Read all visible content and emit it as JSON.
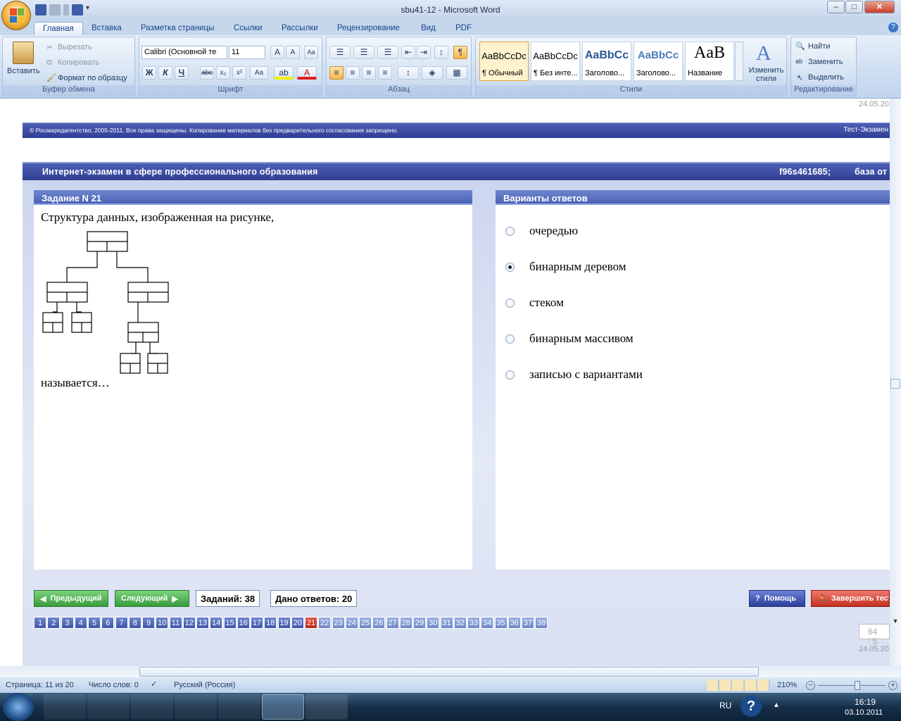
{
  "window": {
    "title": "sbu41-12 - Microsoft Word"
  },
  "tabs": [
    "Главная",
    "Вставка",
    "Разметка страницы",
    "Ссылки",
    "Рассылки",
    "Рецензирование",
    "Вид",
    "PDF"
  ],
  "ribbon": {
    "clipboard": {
      "paste": "Вставить",
      "cut": "Вырезать",
      "copy": "Копировать",
      "format_painter": "Формат по образцу",
      "label": "Буфер обмена"
    },
    "font": {
      "name": "Calibri (Основной те",
      "size": "11",
      "label": "Шрифт"
    },
    "paragraph": {
      "label": "Абзац"
    },
    "styles": {
      "items": [
        {
          "sample": "AaBbCcDc",
          "name": "¶ Обычный"
        },
        {
          "sample": "AaBbCcDc",
          "name": "¶ Без инте..."
        },
        {
          "sample": "AaBbCc",
          "name": "Заголово..."
        },
        {
          "sample": "AaBbCc",
          "name": "Заголово..."
        },
        {
          "sample": "AaB",
          "name": "Название"
        }
      ],
      "change": "Изменить стили",
      "label": "Стили"
    },
    "editing": {
      "find": "Найти",
      "replace": "Заменить",
      "select": "Выделить",
      "label": "Редактирование"
    }
  },
  "doc": {
    "date_top": "24.05.20",
    "copyright": "© Росаккредагентство, 2005-2011. Все права защищены. Копирование материалов без предварительного согласования запрещено.",
    "brand": "Тест-Экзамен",
    "exam_title": "Интернет-экзамен в сфере профессионального образования",
    "session": "f96s461685;",
    "base": "база от",
    "task_header": "Задание N 21",
    "question_start": "Структура данных, изображенная на рисунке,",
    "question_end": "называется…",
    "answers_header": "Варианты ответов",
    "answers": [
      {
        "text": "очередью",
        "selected": false
      },
      {
        "text": "бинарным деревом",
        "selected": true
      },
      {
        "text": "стеком",
        "selected": false
      },
      {
        "text": "бинарным массивом",
        "selected": false
      },
      {
        "text": "записью с вариантами",
        "selected": false
      }
    ],
    "prev": "Предыдущий",
    "next": "Следующий",
    "tasks_count": "Заданий: 38",
    "answered_count": "Дано ответов: 20",
    "help": "Помощь",
    "finish": "Завершить тест",
    "questions": [
      "1",
      "2",
      "3",
      "4",
      "5",
      "6",
      "7",
      "8",
      "9",
      "10",
      "11",
      "12",
      "13",
      "14",
      "15",
      "16",
      "17",
      "18",
      "19",
      "20",
      "21",
      "22",
      "23",
      "24",
      "25",
      "26",
      "27",
      "28",
      "29",
      "30",
      "31",
      "32",
      "33",
      "34",
      "35",
      "36",
      "37",
      "38"
    ],
    "current_question": 21,
    "answered_up_to": 20,
    "timer": "64 : 5",
    "date_bottom": "24.05.20"
  },
  "status": {
    "page": "Страница: 11 из 20",
    "words": "Число слов: 0",
    "lang": "Русский (Россия)",
    "zoom": "210%"
  },
  "taskbar": {
    "lang": "RU",
    "time": "16:19",
    "date": "03.10.2011"
  },
  "colors": {
    "exam_bar": "#3b4ba3",
    "selected_question": "#c4301f",
    "nav_green": "#3a9b3e",
    "finish_red": "#d6453a"
  }
}
